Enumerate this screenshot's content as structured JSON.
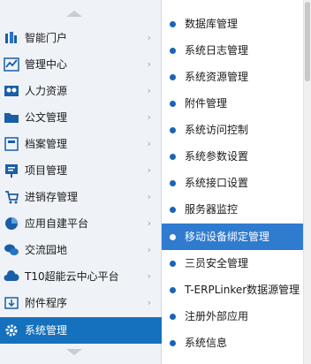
{
  "sidebar": {
    "items": [
      {
        "label": "智能门户",
        "icon": "portal-icon",
        "color": "#1a5ea8"
      },
      {
        "label": "管理中心",
        "icon": "chart-icon",
        "color": "#1a5ea8"
      },
      {
        "label": "人力资源",
        "icon": "people-icon",
        "color": "#1a5ea8"
      },
      {
        "label": "公文管理",
        "icon": "folder-icon",
        "color": "#1a5ea8"
      },
      {
        "label": "档案管理",
        "icon": "archive-icon",
        "color": "#1a5ea8"
      },
      {
        "label": "项目管理",
        "icon": "project-icon",
        "color": "#1a5ea8"
      },
      {
        "label": "进销存管理",
        "icon": "inventory-icon",
        "color": "#1a5ea8"
      },
      {
        "label": "应用自建平台",
        "icon": "pie-icon",
        "color": "#1a5ea8"
      },
      {
        "label": "交流园地",
        "icon": "chat-icon",
        "color": "#1a5ea8"
      },
      {
        "label": "T10超能云中心平台",
        "icon": "cloud-icon",
        "color": "#1a5ea8"
      },
      {
        "label": "附件程序",
        "icon": "attachment-icon",
        "color": "#1a5ea8"
      },
      {
        "label": "系统管理",
        "icon": "gear-icon",
        "color": "#ffffff",
        "active": true
      }
    ],
    "chevron": "›",
    "active_color": "#1570bd"
  },
  "submenu": {
    "items": [
      {
        "label": "数据库管理"
      },
      {
        "label": "系统日志管理"
      },
      {
        "label": "系统资源管理"
      },
      {
        "label": "附件管理"
      },
      {
        "label": "系统访问控制"
      },
      {
        "label": "系统参数设置"
      },
      {
        "label": "系统接口设置"
      },
      {
        "label": "服务器监控"
      },
      {
        "label": "移动设备绑定管理",
        "active": true
      },
      {
        "label": "三员安全管理"
      },
      {
        "label": "T-ERPLinker数据源管理"
      },
      {
        "label": "注册外部应用"
      },
      {
        "label": "系统信息"
      }
    ],
    "active_color": "#2e7bd0"
  }
}
